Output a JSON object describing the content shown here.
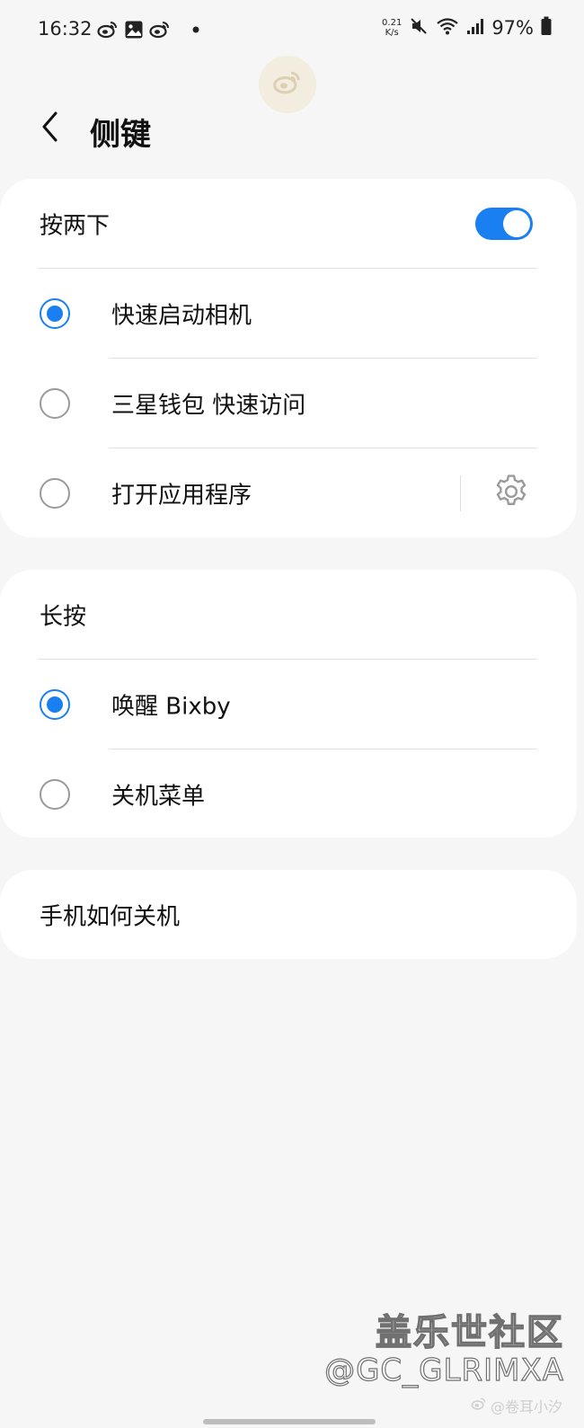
{
  "status_bar": {
    "time": "16:32",
    "net_speed_value": "0.21",
    "net_speed_unit": "K/s",
    "battery": "97%",
    "icons": [
      "weibo-icon",
      "gallery-icon",
      "weibo-icon",
      "dot-icon",
      "mute-icon",
      "wifi-icon",
      "signal-icon",
      "battery-icon"
    ]
  },
  "header": {
    "title": "侧键",
    "back_icon": "chevron-left-icon"
  },
  "double_press": {
    "label": "按两下",
    "enabled": true,
    "options": [
      {
        "label": "快速启动相机",
        "selected": true
      },
      {
        "label": "三星钱包 快速访问",
        "selected": false
      },
      {
        "label": "打开应用程序",
        "selected": false,
        "settings_icon": "gear-icon"
      }
    ]
  },
  "long_press": {
    "label": "长按",
    "options": [
      {
        "label": "唤醒 Bixby",
        "selected": true
      },
      {
        "label": "关机菜单",
        "selected": false
      }
    ]
  },
  "how_to_power_off": {
    "label": "手机如何关机"
  },
  "watermark": {
    "community": "盖乐世社区",
    "handle": "@GC_GLRIMXA",
    "weibo_user": "@卷耳小汐"
  },
  "colors": {
    "accent": "#1a7ff0",
    "background": "#f6f6f6",
    "card": "#ffffff"
  }
}
